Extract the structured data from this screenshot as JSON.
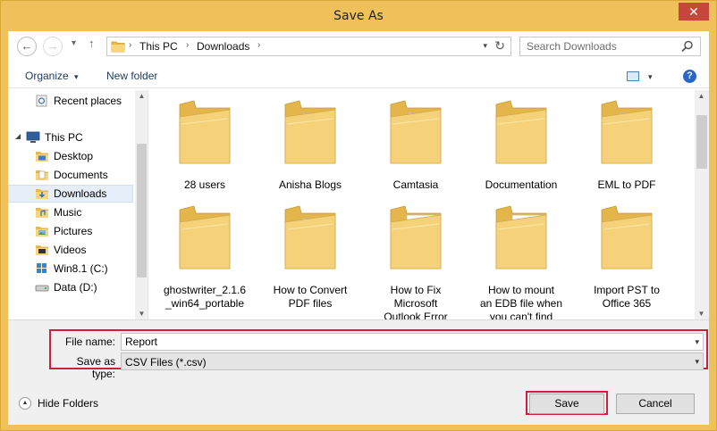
{
  "window": {
    "title": "Save As",
    "close_glyph": "✕"
  },
  "navigation": {
    "back_glyph": "←",
    "forward_glyph": "→",
    "recent_glyph": "▾",
    "up_glyph": "↑",
    "breadcrumbs": [
      "This PC",
      "Downloads"
    ],
    "crumb_separator": "›",
    "refresh_glyph": "↻",
    "search_placeholder": "Search Downloads"
  },
  "toolbar": {
    "organize_label": "Organize",
    "organize_arrow": "▾",
    "new_folder_label": "New folder",
    "view_arrow": "▾",
    "help_glyph": "?"
  },
  "sidebar": {
    "items": [
      {
        "label": "Recent places",
        "icon": "recent-places-icon"
      },
      {
        "label": "This PC",
        "icon": "computer-icon"
      },
      {
        "label": "Desktop",
        "icon": "desktop-icon"
      },
      {
        "label": "Documents",
        "icon": "documents-icon"
      },
      {
        "label": "Downloads",
        "icon": "downloads-icon",
        "selected": true
      },
      {
        "label": "Music",
        "icon": "music-icon"
      },
      {
        "label": "Pictures",
        "icon": "pictures-icon"
      },
      {
        "label": "Videos",
        "icon": "videos-icon"
      },
      {
        "label": "Win8.1 (C:)",
        "icon": "drive-c-icon"
      },
      {
        "label": "Data (D:)",
        "icon": "drive-d-icon"
      }
    ]
  },
  "files": [
    {
      "name": "28 users",
      "kind": "folder"
    },
    {
      "name": "Anisha Blogs",
      "kind": "folder-docs"
    },
    {
      "name": "Camtasia",
      "kind": "folder-docs"
    },
    {
      "name": "Documentation",
      "kind": "folder"
    },
    {
      "name": "EML to PDF",
      "kind": "folder-docs"
    },
    {
      "name": "ghostwriter_2.1.6\n_win64_portable",
      "kind": "folder"
    },
    {
      "name": "How to Convert\nPDF files",
      "kind": "folder-docs"
    },
    {
      "name": "How to Fix\nMicrosoft\nOutlook Error",
      "kind": "folder-word"
    },
    {
      "name": "How to mount\nan EDB file when\nyou can't find",
      "kind": "folder-word"
    },
    {
      "name": "Import PST to\nOffice 365",
      "kind": "folder"
    }
  ],
  "form": {
    "file_name_label": "File name:",
    "file_name_value": "Report",
    "save_type_label": "Save as type:",
    "save_type_value": "CSV Files (*.csv)",
    "dropdown_glyph": "▾",
    "hide_folders_label": "Hide Folders",
    "hide_folders_glyph": "▲",
    "save_label": "Save",
    "cancel_label": "Cancel"
  },
  "scroll_glyphs": {
    "up": "▲",
    "down": "▼"
  },
  "colors": {
    "titlebar": "#f0c15a",
    "close": "#c7463b",
    "highlight": "#d01f3c",
    "folder": "#f5d27a"
  }
}
